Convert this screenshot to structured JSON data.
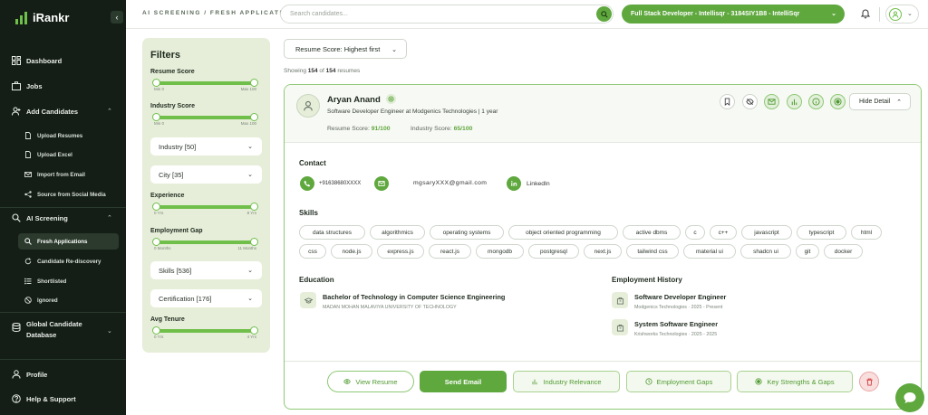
{
  "app": {
    "name": "iRankr"
  },
  "sidebar": {
    "items": [
      {
        "label": "Dashboard",
        "icon": "dashboard-icon"
      },
      {
        "label": "Jobs",
        "icon": "briefcase-icon"
      },
      {
        "label": "Add Candidates",
        "icon": "user-plus-icon"
      },
      {
        "label": "Upload Resumes",
        "icon": "file-icon"
      },
      {
        "label": "Upload Excel",
        "icon": "file-icon"
      },
      {
        "label": "Import from Email",
        "icon": "mail-icon"
      },
      {
        "label": "Source from Social Media",
        "icon": "share-icon"
      },
      {
        "label": "AI Screening",
        "icon": "search-icon"
      },
      {
        "label": "Fresh Applications",
        "icon": "search-icon"
      },
      {
        "label": "Candidate Re-discovery",
        "icon": "refresh-icon"
      },
      {
        "label": "Shortlisted",
        "icon": "list-icon"
      },
      {
        "label": "Ignored",
        "icon": "ban-icon"
      },
      {
        "label": "Global Candidate",
        "icon": "database-icon"
      },
      {
        "label": "Database",
        "icon": ""
      },
      {
        "label": "Profile",
        "icon": "user-icon"
      },
      {
        "label": "Help & Support",
        "icon": "help-icon"
      }
    ]
  },
  "header": {
    "breadcrumb": "AI SCREENING / FRESH APPLICATIONS",
    "search_placeholder": "Search candidates...",
    "job": "Full Stack Developer - Intellisqr - 3184SIY1B8 - IntelliSqr"
  },
  "filters": {
    "title": "Filters",
    "resume_score": {
      "label": "Resume Score",
      "min": "Min 0",
      "max": "Max 100"
    },
    "industry_score": {
      "label": "Industry Score",
      "min": "Min 0",
      "max": "Max 100"
    },
    "industry": "Industry [50]",
    "city": "City [35]",
    "experience": {
      "label": "Experience",
      "min": "0 Yrs",
      "max": "8 Yrs"
    },
    "employment_gap": {
      "label": "Employment Gap",
      "min": "0 Months",
      "max": "11 Months"
    },
    "skills": "Skills [536]",
    "certification": "Certification [176]",
    "avg_tenure": {
      "label": "Avg Tenure",
      "min": "0 Yrs",
      "max": "4 Yrs"
    }
  },
  "list": {
    "sort": "Resume Score: Highest first",
    "showing_prefix": "Showing",
    "count_shown": "154",
    "of": "of",
    "count_total": "154",
    "suffix": "resumes"
  },
  "candidate": {
    "name": "Aryan Anand",
    "role": "Software Developer Engineer at Modgenics Technologies | 1 year",
    "resume_score_label": "Resume Score:",
    "resume_score": "91/100",
    "industry_score_label": "Industry Score:",
    "industry_score": "65/100",
    "hide_detail": "Hide Detail",
    "contact_title": "Contact",
    "phone": "+91638680XXXX",
    "email": "mgsaryXXX@gmail.com",
    "linkedin": "LinkedIn",
    "skills_title": "Skills",
    "skills": [
      "data structures",
      "algorithmics",
      "operating systems",
      "object oriented programming",
      "active dbms",
      "c",
      "c++",
      "javascript",
      "typescript",
      "html",
      "css",
      "node.js",
      "express.js",
      "react.js",
      "mongodb",
      "postgresql",
      "next.js",
      "tailwind css",
      "material ui",
      "shadcn ui",
      "git",
      "docker"
    ],
    "education_title": "Education",
    "education": {
      "degree": "Bachelor of Technology in Computer Science Engineering",
      "school": "MADAN MOHAN MALAVIYA UNIVERSITY OF TECHNOLOGY"
    },
    "employment_title": "Employment History",
    "employment": [
      {
        "title": "Software Developer Engineer",
        "detail": "Modgenics Technologies · 2025 - Present"
      },
      {
        "title": "System Software Engineer",
        "detail": "Krishworks Technologies · 2025 - 2025"
      }
    ]
  },
  "actions": {
    "view_resume": "View Resume",
    "send_email": "Send Email",
    "industry_relevance": "Industry Relevance",
    "employment_gaps": "Employment Gaps",
    "key_strengths": "Key Strengths & Gaps"
  },
  "colors": {
    "accent": "#5fa83e",
    "sidebar_bg": "#141e16",
    "filter_bg": "#e6eed9"
  }
}
